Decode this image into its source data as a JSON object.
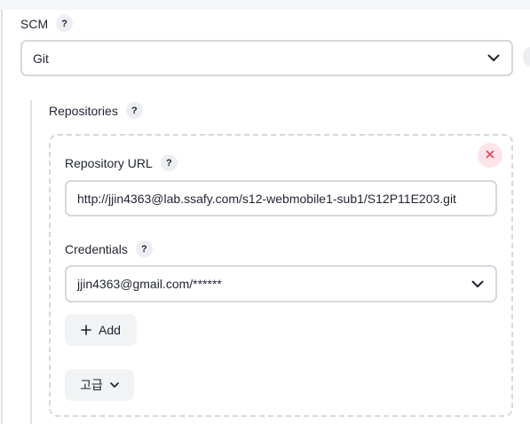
{
  "scm": {
    "label": "SCM",
    "help_glyph": "?",
    "selected": "Git"
  },
  "repositories": {
    "label": "Repositories",
    "help_glyph": "?"
  },
  "repository": {
    "url_label": "Repository URL",
    "url_help_glyph": "?",
    "url_value": "http://jjin4363@lab.ssafy.com/s12-webmobile1-sub1/S12P11E203.git",
    "credentials_label": "Credentials",
    "credentials_help_glyph": "?",
    "credentials_selected": "jjin4363@gmail.com/******",
    "add_label": "Add",
    "advanced_label": "고급"
  },
  "icons": {
    "help": "question-mark-icon",
    "dropdown": "chevron-down-icon",
    "remove": "close-icon",
    "add": "plus-icon"
  },
  "colors": {
    "border": "#d5d8de",
    "close_bg": "#fde4e8",
    "close_x": "#e0435a",
    "button_bg": "#f2f3f5",
    "help_bg": "#eceef2"
  }
}
